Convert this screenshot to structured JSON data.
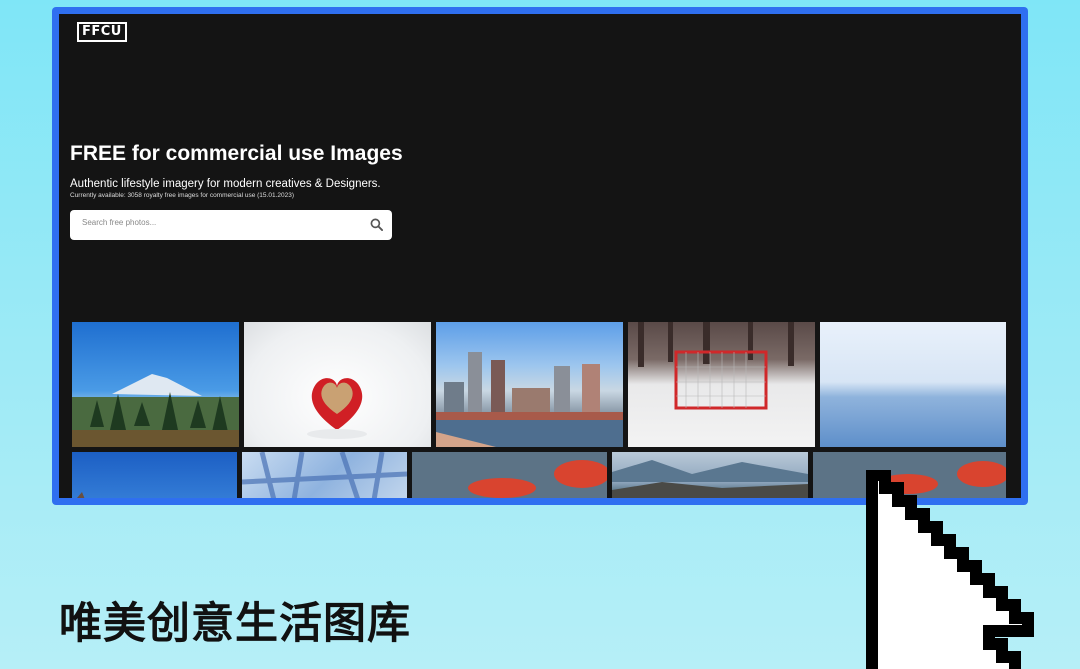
{
  "site": {
    "logo": "FFCU",
    "title": "FREE for commercial use Images",
    "subtitle": "Authentic lifestyle imagery for modern creatives & Designers.",
    "note": "Currently available: 3058 royalty free images for commercial use (15.01.2023)"
  },
  "search": {
    "placeholder": "Search free photos...",
    "icon": "search-icon"
  },
  "photos": [
    {
      "subject": "mountain-landscape"
    },
    {
      "subject": "heart-cup-in-snow"
    },
    {
      "subject": "city-skyline-harbor"
    },
    {
      "subject": "hockey-net-in-snow"
    },
    {
      "subject": "frozen-lake"
    },
    {
      "subject": "blue-sky"
    },
    {
      "subject": "tree-shadows"
    },
    {
      "subject": "red-leaves"
    },
    {
      "subject": "rocky-coast"
    },
    {
      "subject": "red-leaves"
    }
  ],
  "caption": "唯美创意生活图库",
  "colors": {
    "frame": "#2f6ff0",
    "screen": "#141414",
    "background": "#8ee8f6"
  }
}
